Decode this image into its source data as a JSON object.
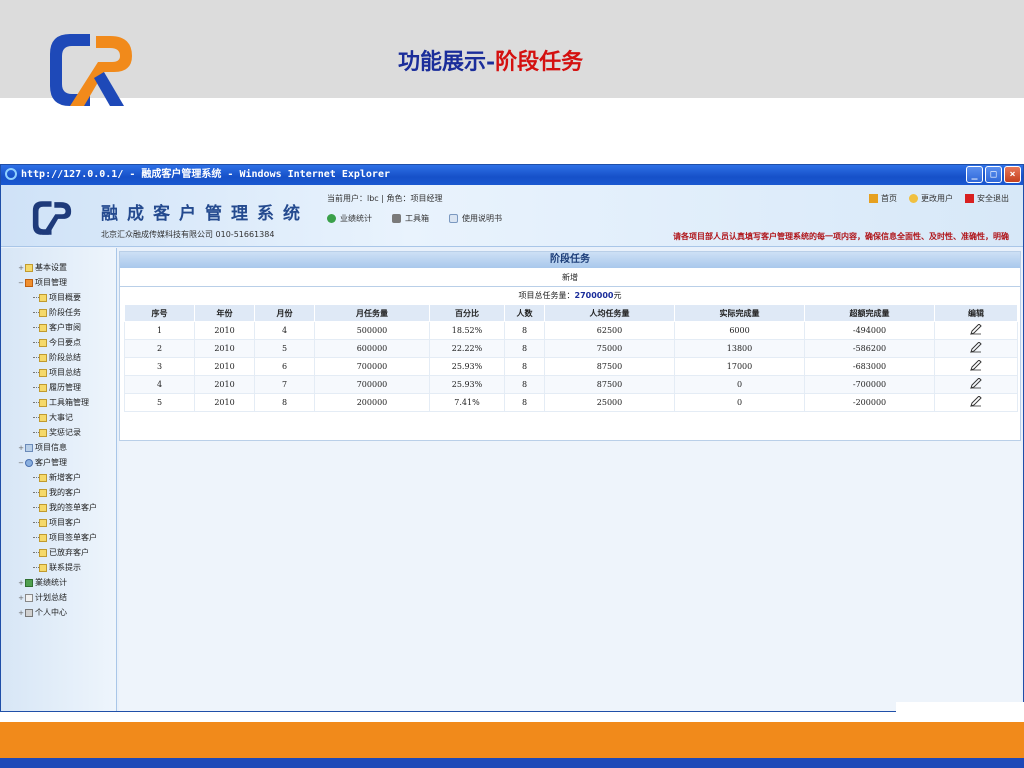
{
  "slide": {
    "title_part1": "功能展示-",
    "title_part2": "阶段任务",
    "colors": {
      "title_blue": "#1a2d9a",
      "title_red": "#d4100f",
      "logo_blue": "#1e49b8",
      "logo_orange": "#f18a1b",
      "footer_orange": "#f18a1b",
      "footer_blue": "#1e49b8"
    }
  },
  "window": {
    "title": "http://127.0.0.1/ - 融成客户管理系统 - Windows Internet Explorer",
    "buttons": [
      "minimize-icon",
      "maximize-icon",
      "close-icon"
    ]
  },
  "header": {
    "app_name": "融成客户管理系统",
    "company": "北京汇众融成传媒科技有限公司  010-51661384",
    "user_info": "当前用户：lbc  | 角色：项目经理",
    "toolbar": [
      "业绩统计",
      "工具箱",
      "使用说明书"
    ],
    "links": [
      "首页",
      "更改用户",
      "安全退出"
    ],
    "notice": "请各项目部人员认真填写客户管理系统的每一项内容，确保信息全面性、及时性、准确性，明确"
  },
  "sidebar": {
    "items": [
      {
        "label": "基本设置",
        "level": 1
      },
      {
        "label": "项目管理",
        "level": 1
      },
      {
        "label": "项目概要",
        "level": 2
      },
      {
        "label": "阶段任务",
        "level": 2
      },
      {
        "label": "客户审阅",
        "level": 2
      },
      {
        "label": "今日要点",
        "level": 2
      },
      {
        "label": "阶段总结",
        "level": 2
      },
      {
        "label": "项目总结",
        "level": 2
      },
      {
        "label": "履历管理",
        "level": 2
      },
      {
        "label": "工具箱管理",
        "level": 2
      },
      {
        "label": "大事记",
        "level": 2
      },
      {
        "label": "奖惩记录",
        "level": 2
      },
      {
        "label": "项目信息",
        "level": 1
      },
      {
        "label": "客户管理",
        "level": 1
      },
      {
        "label": "新增客户",
        "level": 2
      },
      {
        "label": "我的客户",
        "level": 2
      },
      {
        "label": "我的签单客户",
        "level": 2
      },
      {
        "label": "项目客户",
        "level": 2
      },
      {
        "label": "项目签单客户",
        "level": 2
      },
      {
        "label": "已放弃客户",
        "level": 2
      },
      {
        "label": "联系提示",
        "level": 2
      },
      {
        "label": "業绩统计",
        "level": 1
      },
      {
        "label": "计划总结",
        "level": 1
      },
      {
        "label": "个人中心",
        "level": 1
      }
    ]
  },
  "main": {
    "panel_title": "阶段任务",
    "add_label": "新增",
    "total_label": "项目总任务量：",
    "total_value": "2700000",
    "total_unit": "元",
    "columns": [
      "序号",
      "年份",
      "月份",
      "月任务量",
      "百分比",
      "人数",
      "人均任务量",
      "实际完成量",
      "超额完成量",
      "编辑"
    ],
    "rows": [
      [
        "1",
        "2010",
        "4",
        "500000",
        "18.52%",
        "8",
        "62500",
        "6000",
        "-494000"
      ],
      [
        "2",
        "2010",
        "5",
        "600000",
        "22.22%",
        "8",
        "75000",
        "13800",
        "-586200"
      ],
      [
        "3",
        "2010",
        "6",
        "700000",
        "25.93%",
        "8",
        "87500",
        "17000",
        "-683000"
      ],
      [
        "4",
        "2010",
        "7",
        "700000",
        "25.93%",
        "8",
        "87500",
        "0",
        "-700000"
      ],
      [
        "5",
        "2010",
        "8",
        "200000",
        "7.41%",
        "8",
        "25000",
        "0",
        "-200000"
      ]
    ]
  }
}
